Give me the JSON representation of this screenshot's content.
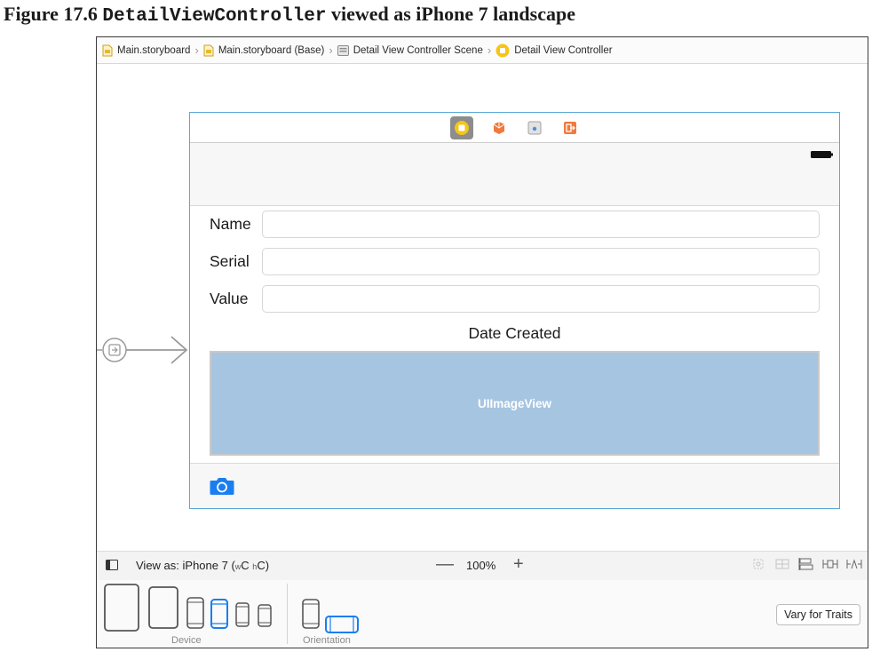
{
  "caption": {
    "prefix": "Figure 17.6",
    "code": "DetailViewController",
    "suffix": "viewed as iPhone 7 landscape"
  },
  "breadcrumb": {
    "items": [
      "Main.storyboard",
      "Main.storyboard (Base)",
      "Detail View Controller Scene",
      "Detail View Controller"
    ]
  },
  "scene": {
    "dock_icons": [
      "view-controller-icon",
      "first-responder-icon",
      "scene-object-icon",
      "exit-icon"
    ],
    "form": {
      "name_label": "Name",
      "serial_label": "Serial",
      "value_label": "Value",
      "name_value": "",
      "serial_value": "",
      "value_value": ""
    },
    "date_label": "Date Created",
    "image_view_label": "UIImageView",
    "toolbar_icon": "camera-icon"
  },
  "zoom_bar": {
    "view_as_prefix": "View as: iPhone 7 (",
    "w_small": "w",
    "c1": "C",
    "h_small": "h",
    "c2": "C)",
    "zoom_level": "100%",
    "minus": "—",
    "plus": "+"
  },
  "device_bar": {
    "device_caption": "Device",
    "orientation_caption": "Orientation",
    "selected_device": "iPhone 7",
    "selected_orientation": "landscape",
    "vary_button": "Vary for Traits"
  },
  "colors": {
    "accent": "#1a7ef0",
    "scene_border": "#5aa9d8",
    "image_view": "#a6c5e1",
    "dock_orange": "#f07a3c"
  }
}
